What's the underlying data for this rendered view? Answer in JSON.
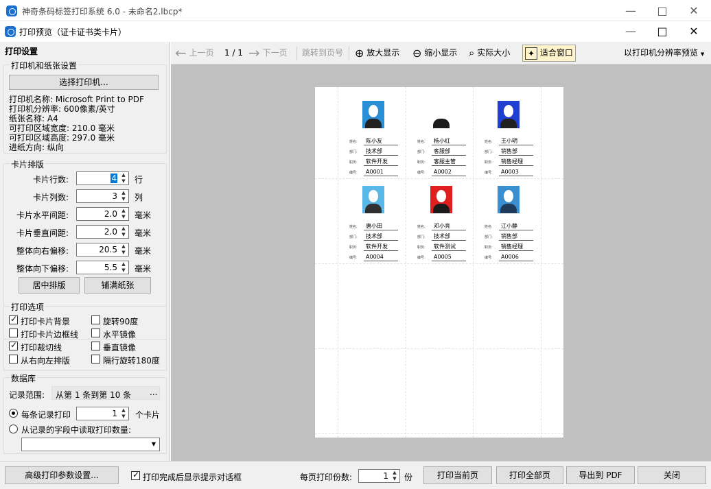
{
  "app": {
    "title": "神奇条码标签打印系统 6.0 - 未命名2.lbcp*"
  },
  "dialog": {
    "title": "打印预览（证卡证书类卡片）"
  },
  "left": {
    "header": "打印设置",
    "printer_group": {
      "title": "打印机和纸张设置",
      "select_button": "选择打印机...",
      "info": [
        "打印机名称: Microsoft Print to PDF",
        "打印机分辨率: 600像素/英寸",
        "纸张名称: A4",
        "可打印区域宽度: 210.0 毫米",
        "可打印区域高度: 297.0 毫米",
        "进纸方向: 纵向"
      ]
    },
    "layout_group": {
      "title": "卡片排版",
      "rows": [
        {
          "label": "卡片行数:",
          "value": "4",
          "unit": "行"
        },
        {
          "label": "卡片列数:",
          "value": "3",
          "unit": "列"
        },
        {
          "label": "卡片水平间距:",
          "value": "2.0",
          "unit": "毫米"
        },
        {
          "label": "卡片垂直间距:",
          "value": "2.0",
          "unit": "毫米"
        },
        {
          "label": "整体向右偏移:",
          "value": "20.5",
          "unit": "毫米"
        },
        {
          "label": "整体向下偏移:",
          "value": "5.5",
          "unit": "毫米"
        }
      ],
      "center_button": "居中排版",
      "fill_button": "铺满纸张"
    },
    "options_group": {
      "title": "打印选项",
      "left": [
        {
          "label": "打印卡片背景",
          "checked": true
        },
        {
          "label": "打印卡片边框线",
          "checked": false
        },
        {
          "label": "打印裁切线",
          "checked": true
        },
        {
          "label": "从右向左排版",
          "checked": false
        }
      ],
      "right": [
        {
          "label": "旋转90度",
          "checked": false
        },
        {
          "label": "水平镜像",
          "checked": false
        },
        {
          "label": "垂直镜像",
          "checked": false
        },
        {
          "label": "隔行旋转180度",
          "checked": false
        }
      ]
    },
    "db_group": {
      "title": "数据库",
      "range_label": "记录范围:",
      "range_value": "从第 1 条到第 10 条",
      "range_button": "...",
      "each_label": "每条记录打印",
      "each_value": "1",
      "each_unit": "个卡片",
      "field_label": "从记录的字段中读取打印数量:"
    }
  },
  "toolbar": {
    "prev": "上一页",
    "page": "1 / 1",
    "next": "下一页",
    "goto": "跳转到页号",
    "zoom_in": "放大显示",
    "zoom_out": "缩小显示",
    "actual": "实际大小",
    "fit": "适合窗口",
    "resolution": "以打印机分辨率预览"
  },
  "cards": [
    {
      "name": "陈小友",
      "dept": "技术部",
      "job": "软件开发",
      "id": "A0001",
      "bg": "#2a8fd6",
      "shirt": "#222222"
    },
    {
      "name": "杨小红",
      "dept": "客服部",
      "job": "客服主管",
      "id": "A0002",
      "bg": "#ffffff",
      "shirt": "#1c1c1c"
    },
    {
      "name": "王小明",
      "dept": "销售部",
      "job": "销售经理",
      "id": "A0003",
      "bg": "#1f3fd0",
      "shirt": "#202020"
    },
    {
      "name": "唐小田",
      "dept": "技术部",
      "job": "软件开发",
      "id": "A0004",
      "bg": "#5ab8e8",
      "shirt": "#303030"
    },
    {
      "name": "邓小亮",
      "dept": "技术部",
      "job": "软件测试",
      "id": "A0005",
      "bg": "#e02020",
      "shirt": "#1a1a1a"
    },
    {
      "name": "江小静",
      "dept": "销售部",
      "job": "销售经理",
      "id": "A0006",
      "bg": "#3a8fd0",
      "shirt": "#1f3a5a"
    }
  ],
  "card_labels": {
    "name": "姓名:",
    "dept": "部门:",
    "job": "职务:",
    "id": "编号:"
  },
  "bottom": {
    "advanced": "高级打印参数设置...",
    "show_dialog": "打印完成后显示提示对话框",
    "copies_label": "每页打印份数:",
    "copies_value": "1",
    "copies_unit": "份",
    "print_current": "打印当前页",
    "print_all": "打印全部页",
    "export_pdf": "导出到 PDF",
    "close": "关闭"
  }
}
